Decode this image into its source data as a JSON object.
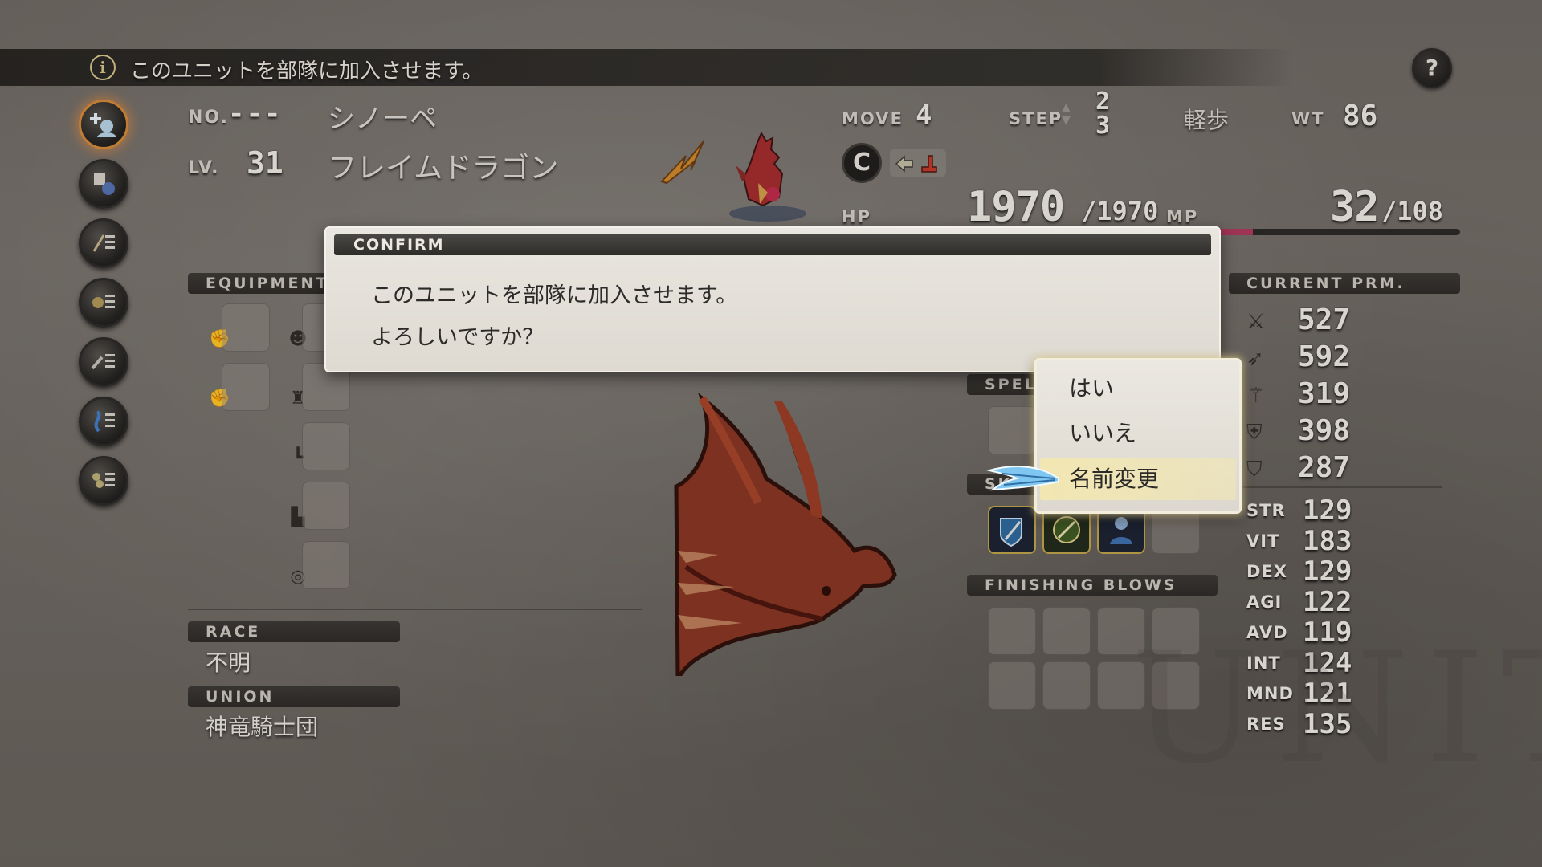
{
  "info_bar": {
    "icon": "info-icon",
    "text": "このユニットを部隊に加入させます。"
  },
  "help_button": {
    "label": "?"
  },
  "unit": {
    "no_label": "NO.",
    "no_value": "---",
    "name": "シノーペ",
    "lv_label": "LV.",
    "lv_value": "31",
    "class": "フレイムドラゴン",
    "move_label": "MOVE",
    "move_value": "4",
    "step_label": "STEP",
    "step_up": "2",
    "step_down": "3",
    "trait": "軽歩",
    "wt_label": "WT",
    "wt_value": "86",
    "hp_label": "HP",
    "hp_current": "1970",
    "hp_max": "/1970",
    "mp_label": "MP",
    "mp_current": "32",
    "mp_max": "/108",
    "mp_fraction": 0.296,
    "rank": "C"
  },
  "sections": {
    "equipment": "EQUIPMENT",
    "spells": "SPEL",
    "skills": "SK",
    "finishing": "FINISHING BLOWS",
    "current_prm": "CURRENT PRM.",
    "race": "RACE",
    "union": "UNION"
  },
  "race_value": "不明",
  "union_value": "神竜騎士団",
  "current_prm": [
    {
      "icon": "sword-icon",
      "value": "527"
    },
    {
      "icon": "bow-icon",
      "value": "592"
    },
    {
      "icon": "wand-icon",
      "value": "319"
    },
    {
      "icon": "shield-icon",
      "value": "398"
    },
    {
      "icon": "magic-shield-icon",
      "value": "287"
    }
  ],
  "stats": [
    {
      "key": "STR",
      "value": "129"
    },
    {
      "key": "VIT",
      "value": "183"
    },
    {
      "key": "DEX",
      "value": "129"
    },
    {
      "key": "AGI",
      "value": "122"
    },
    {
      "key": "AVD",
      "value": "119"
    },
    {
      "key": "INT",
      "value": "124"
    },
    {
      "key": "MND",
      "value": "121"
    },
    {
      "key": "RES",
      "value": "135"
    }
  ],
  "watermark": "UNIT",
  "confirm": {
    "title": "CONFIRM",
    "line1": "このユニットを部隊に加入させます。",
    "line2": "よろしいですか？"
  },
  "menu": {
    "options": [
      "はい",
      "いいえ",
      "名前変更"
    ],
    "selected_index": 2
  },
  "sidebar_icons": [
    "unit-join-icon",
    "profile-list-icon",
    "equipment-list-icon",
    "item-list-icon",
    "skill-list-icon",
    "spell-list-icon",
    "finishing-list-icon"
  ],
  "colors": {
    "mp_bar": "#b0385e",
    "cursor": "#7fc6f0",
    "menu_highlight": "#f3e7b0",
    "active_ring": "#d58a3a"
  }
}
